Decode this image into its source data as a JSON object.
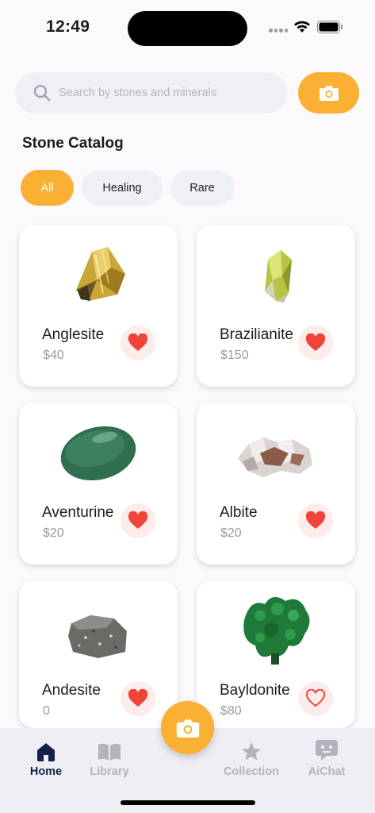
{
  "status": {
    "time": "12:49"
  },
  "search": {
    "placeholder": "Search by stones and minerals"
  },
  "catalog": {
    "title": "Stone Catalog"
  },
  "filters": [
    {
      "label": "All",
      "active": true
    },
    {
      "label": "Healing",
      "active": false
    },
    {
      "label": "Rare",
      "active": false
    }
  ],
  "stones": [
    {
      "name": "Anglesite",
      "price": "$40",
      "favorite": true
    },
    {
      "name": "Brazilianite",
      "price": "$150",
      "favorite": true
    },
    {
      "name": "Aventurine",
      "price": "$20",
      "favorite": true
    },
    {
      "name": "Albite",
      "price": "$20",
      "favorite": true
    },
    {
      "name": "Andesite",
      "price": "0",
      "favorite": true
    },
    {
      "name": "Bayldonite",
      "price": "$80",
      "favorite": false
    }
  ],
  "tabs": [
    {
      "label": "Home",
      "icon": "home-icon",
      "active": true
    },
    {
      "label": "Library",
      "icon": "book-icon",
      "active": false
    },
    {
      "label": "Collection",
      "icon": "star-icon",
      "active": false
    },
    {
      "label": "AiChat",
      "icon": "chat-bot-icon",
      "active": false
    }
  ],
  "colors": {
    "accent": "#f9b033",
    "favorite": "#f0443a",
    "active_tab": "#15214c"
  }
}
